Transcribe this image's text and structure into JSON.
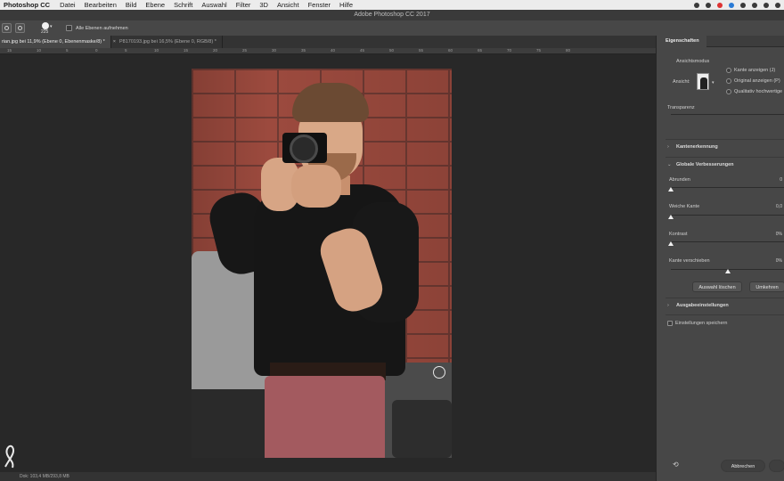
{
  "menubar": {
    "app": "Photoshop CC",
    "items": [
      "Datei",
      "Bearbeiten",
      "Bild",
      "Ebene",
      "Schrift",
      "Auswahl",
      "Filter",
      "3D",
      "Ansicht",
      "Fenster",
      "Hilfe"
    ]
  },
  "window_title": "Adobe Photoshop CC 2017",
  "options": {
    "brush_size": "225",
    "checkbox_label": "Alle Ebenen aufnehmen"
  },
  "tabs": [
    {
      "label": "rian.jpg bei 11,9% (Ebene 0, Ebenenmaske/8) *",
      "active": true
    },
    {
      "label": "P8170193.jpg bei 16,5% (Ebene 0, RGB/8) *",
      "active": false
    }
  ],
  "ruler_ticks": [
    "15",
    "10",
    "5",
    "0",
    "5",
    "10",
    "15",
    "20",
    "25",
    "30",
    "35",
    "40",
    "45",
    "50",
    "55",
    "60",
    "65",
    "70",
    "75",
    "80"
  ],
  "status": "Dok: 103,4 MB/293,8 MB",
  "panel": {
    "tab_title": "Eigenschaften",
    "view_mode_label": "Ansichtsmodus",
    "view_label": "Ansicht:",
    "checks": [
      "Kante anzeigen (J)",
      "Original anzeigen (P)",
      "Qualitativ hochwertige"
    ],
    "transparency_label": "Transparenz",
    "edge_detection": "Kantenerkennung",
    "global_refinements": "Globale Verbesserungen",
    "sliders": [
      {
        "label": "Abrunden",
        "value": "0",
        "level": 0.0
      },
      {
        "label": "Weiche Kante",
        "value": "0,0",
        "level": 0.0
      },
      {
        "label": "Kontrast",
        "value": "0%",
        "level": 0.0
      },
      {
        "label": "Kante verschieben",
        "value": "0%",
        "level": 0.5
      }
    ],
    "clear_selection": "Auswahl löschen",
    "invert": "Umkehren",
    "output_settings": "Ausgabeeinstellungen",
    "save_settings": "Einstellungen speichern",
    "cancel": "Abbrechen"
  }
}
